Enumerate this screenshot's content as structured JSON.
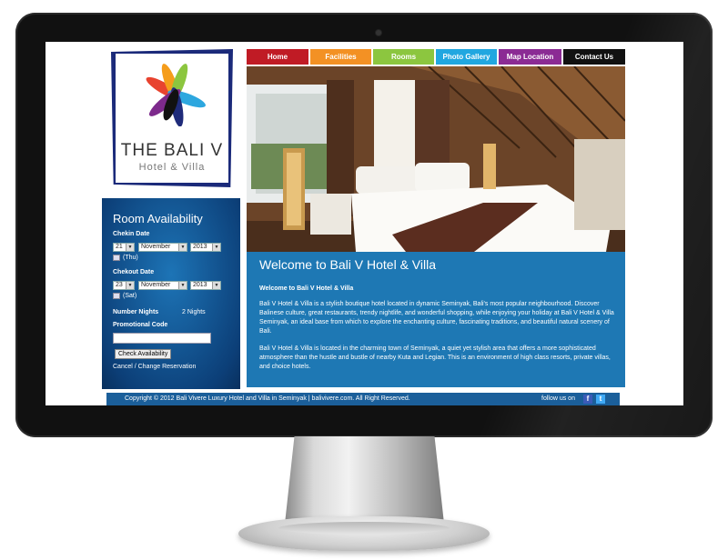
{
  "logo": {
    "title": "THE BALI V",
    "subtitle": "Hotel & Villa"
  },
  "nav": [
    {
      "label": "Home",
      "color": "#c01b25",
      "width": 68
    },
    {
      "label": "Facilities",
      "color": "#f39124",
      "width": 67
    },
    {
      "label": "Rooms",
      "color": "#8cc63f",
      "width": 67
    },
    {
      "label": "Photo Gallery",
      "color": "#21a7e0",
      "width": 67
    },
    {
      "label": "Map Location",
      "color": "#8b2b94",
      "width": 69
    },
    {
      "label": "Contact Us",
      "color": "#111111",
      "width": 68
    }
  ],
  "availability": {
    "title": "Room Availability",
    "checkin_label": "Chekin Date",
    "checkin_day": "21",
    "checkin_month": "November",
    "checkin_year": "2013",
    "checkin_weekday": "(Thu)",
    "checkout_label": "Chekout Date",
    "checkout_day": "23",
    "checkout_month": "November",
    "checkout_year": "2013",
    "checkout_weekday": "(Sat)",
    "nights_label": "Number Nights",
    "nights_value": "2 Nights",
    "promo_label": "Promotional Code",
    "promo_value": "",
    "check_button": "Check Availability",
    "cancel_link": "Cancel / Change Reservation"
  },
  "welcome": {
    "heading": "Welcome to Bali V Hotel & Villa",
    "subheading": "Welcome to Bali V Hotel & Villa",
    "p1": "Bali V Hotel & Villa is a stylish boutique hotel located in dynamic Seminyak, Bali's most popular neighbourhood. Discover Balinese culture, great restaurants, trendy nightlife, and wonderful shopping, while enjoying your holiday at Bali V Hotel & Villa Seminyak, an ideal base from which to explore the enchanting culture, fascinating traditions, and beautiful natural scenery of Bali.",
    "p2": "Bali V Hotel & Villa is located in the charming town of Seminyak, a quiet yet stylish area that offers a more sophisticated atmosphere than the hustle and bustle of nearby Kuta and Legian. This is an environment of high class resorts, private villas, and choice hotels."
  },
  "footer": {
    "copyright": "Copyright © 2012 Bali Vivere Luxury Hotel and Villa in Seminyak | balivivere.com. All Right Reserved.",
    "follow": "follow us on",
    "facebook_glyph": "f",
    "twitter_glyph": "t"
  }
}
